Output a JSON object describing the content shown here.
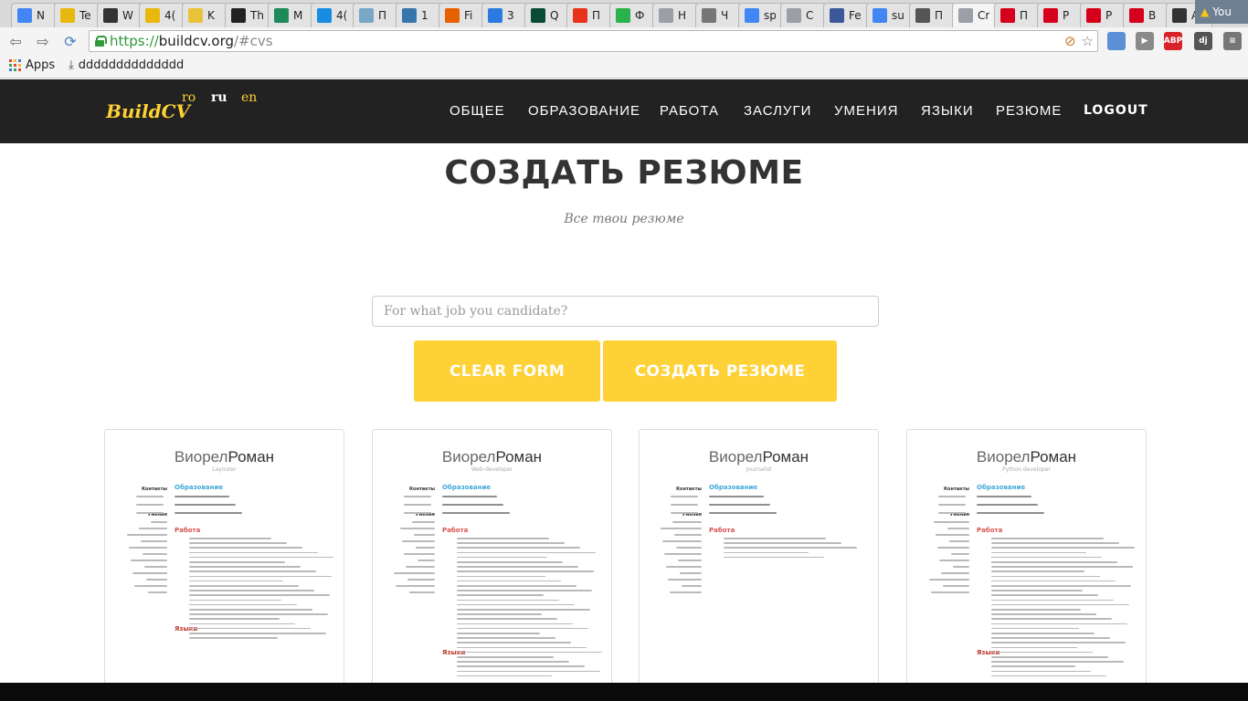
{
  "browser": {
    "tabs": [
      {
        "label": "N",
        "icon": "google-icon",
        "color": "#4285f4"
      },
      {
        "label": "Te",
        "icon": "ad-icon",
        "color": "#e8b80c"
      },
      {
        "label": "W",
        "icon": "web-icon",
        "color": "#333333"
      },
      {
        "label": "4(",
        "icon": "ad-icon",
        "color": "#e8b80c"
      },
      {
        "label": "K",
        "icon": "bookmark-icon",
        "color": "#e8c33a"
      },
      {
        "label": "Th",
        "icon": "sa-icon",
        "color": "#222222"
      },
      {
        "label": "M",
        "icon": "m-icon",
        "color": "#1e8a5a"
      },
      {
        "label": "4(",
        "icon": "mail-ru-icon",
        "color": "#168de2"
      },
      {
        "label": "П",
        "icon": "h-icon",
        "color": "#7aa7c7"
      },
      {
        "label": "1",
        "icon": "python-icon",
        "color": "#3776ab"
      },
      {
        "label": "Fi",
        "icon": "fire-icon",
        "color": "#e66000"
      },
      {
        "label": "3",
        "icon": "shield-icon",
        "color": "#2a7ae2"
      },
      {
        "label": "Q",
        "icon": "django-icon",
        "color": "#0c4b33"
      },
      {
        "label": "П",
        "icon": "opera-icon",
        "color": "#e8331c"
      },
      {
        "label": "Ф",
        "icon": "feedly-icon",
        "color": "#2bb24c"
      },
      {
        "label": "Н",
        "icon": "page-icon",
        "color": "#9aa0a6"
      },
      {
        "label": "Ч",
        "icon": "robot-icon",
        "color": "#777777"
      },
      {
        "label": "sp",
        "icon": "google-icon",
        "color": "#4285f4"
      },
      {
        "label": "С",
        "icon": "page-icon",
        "color": "#9aa0a6"
      },
      {
        "label": "Fe",
        "icon": "facebook-icon",
        "color": "#3b5998"
      },
      {
        "label": "su",
        "icon": "google-icon",
        "color": "#4285f4"
      },
      {
        "label": "П",
        "icon": "envelope-icon",
        "color": "#555555"
      },
      {
        "label": "Cr",
        "icon": "page-icon",
        "color": "#9aa0a6",
        "active": true
      },
      {
        "label": "П",
        "icon": "hh-icon",
        "color": "#d6001c"
      },
      {
        "label": "Р",
        "icon": "hh-icon",
        "color": "#d6001c"
      },
      {
        "label": "Р",
        "icon": "hh-icon",
        "color": "#d6001c"
      },
      {
        "label": "В",
        "icon": "hh-icon",
        "color": "#d6001c"
      },
      {
        "label": "А",
        "icon": "terminal-icon",
        "color": "#333333"
      }
    ],
    "user_label": "You",
    "url": {
      "scheme": "https://",
      "host": "buildcv.org",
      "path": "/#cvs"
    },
    "bookmarks": {
      "apps_label": "Apps",
      "download_label": "dddddddddddddd"
    },
    "extensions": [
      {
        "name": "folder-icon",
        "label": "",
        "color": "#5b8fd6"
      },
      {
        "name": "play-icon",
        "label": "▶",
        "color": "#8a8a8a"
      },
      {
        "name": "adblock-icon",
        "label": "ABP",
        "color": "#d8232a"
      },
      {
        "name": "dj-icon",
        "label": "dj",
        "color": "#555555"
      },
      {
        "name": "menu-icon",
        "label": "≡",
        "color": "#777777"
      }
    ]
  },
  "site": {
    "brand": "BuildCV",
    "langs": {
      "ro": "ro",
      "ru": "ru",
      "en": "en"
    },
    "nav": [
      "ОБЩЕЕ",
      "ОБРАЗОВАНИЕ",
      "РАБОТА",
      "ЗАСЛУГИ",
      "УМЕНИЯ",
      "ЯЗЫКИ",
      "РЕЗЮМЕ",
      "LOGOUT"
    ],
    "accent_color": "#fed136",
    "heading": "СОЗДАТЬ РЕЗЮМЕ",
    "subheading": "Все твои резюме",
    "job_input": {
      "value": "",
      "placeholder": "For what job you candidate?"
    },
    "buttons": {
      "clear": "CLEAR FORM",
      "create": "СОЗДАТЬ РЕЗЮМЕ"
    }
  },
  "cvs": [
    {
      "first": "Виорел",
      "last": "Роман",
      "role": "Layouter"
    },
    {
      "first": "Виорел",
      "last": "Роман",
      "role": "Web-developer"
    },
    {
      "first": "Виорел",
      "last": "Роман",
      "role": "Journalist"
    },
    {
      "first": "Виорел",
      "last": "Роман",
      "role": "Python developer"
    }
  ],
  "cv_sections": {
    "contacts": "Контакты",
    "education": "Образование",
    "skills": "Умения",
    "work": "Работа",
    "languages": "Языки"
  }
}
